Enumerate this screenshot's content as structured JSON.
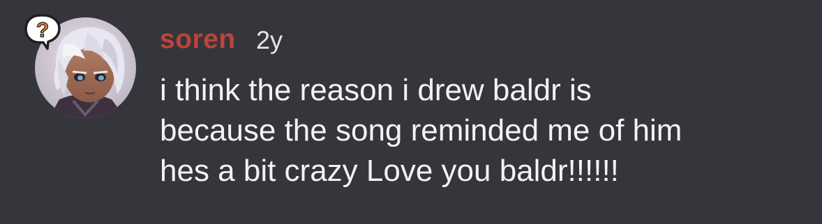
{
  "message": {
    "author": "soren",
    "timestamp": "2y",
    "lines": [
      "i think the reason i drew baldr is",
      "because the song reminded me of him",
      "hes a bit crazy Love you baldr!!!!!!"
    ],
    "badge_glyph": "?"
  },
  "colors": {
    "background": "#35363c",
    "author": "#c0423a",
    "text": "#f2f3f5",
    "badge": "#e07b2a"
  },
  "icons": {
    "avatar": "anime-character-avatar",
    "badge": "question-mark-speech-bubble-icon"
  }
}
